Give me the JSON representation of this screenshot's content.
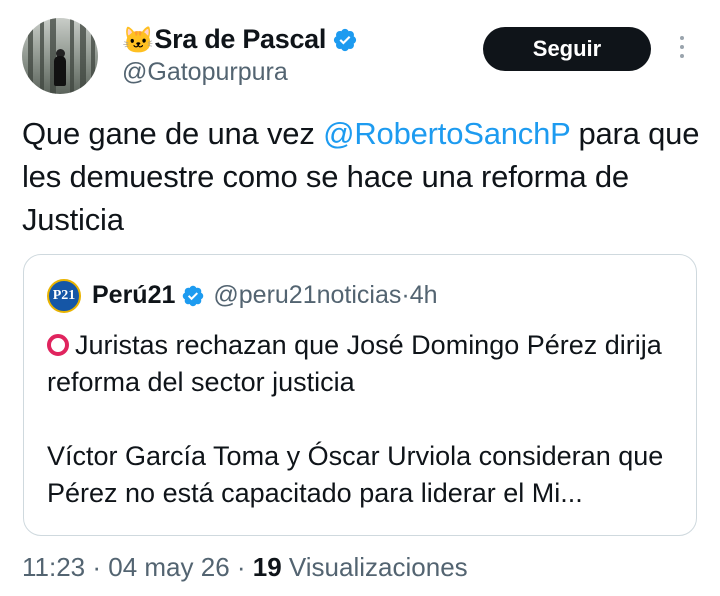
{
  "author": {
    "emoji": "🐱",
    "name": "Sra de Pascal",
    "handle": "@Gatopurpura"
  },
  "follow_label": "Seguir",
  "tweet": {
    "part1": "Que gane de una vez ",
    "mention": "@RobertoSanchP",
    "part2": " para que les demuestre como se hace una reforma de Justicia"
  },
  "quoted": {
    "logo_text": "P21",
    "name": "Perú21",
    "handle": "@peru21noticias",
    "separator": " · ",
    "time": "4h",
    "line1": "Juristas rechazan que José Domingo Pérez dirija reforma del sector justicia",
    "line2": "Víctor García Toma y Óscar Urviola consideran que Pérez no está capacitado para liderar el Mi..."
  },
  "meta": {
    "time": "11:23",
    "dot": " · ",
    "date": "04 may 26",
    "views_count": "19",
    "views_label": " Visualizaciones"
  },
  "colors": {
    "accent": "#1d9bf0",
    "text": "#0f1419",
    "muted": "#536471",
    "button_bg": "#0f1419",
    "alert_red": "#e0245e"
  },
  "icons": [
    "verified-badge-icon",
    "more-options-icon",
    "red-circle-icon",
    "cat-emoji-icon"
  ]
}
